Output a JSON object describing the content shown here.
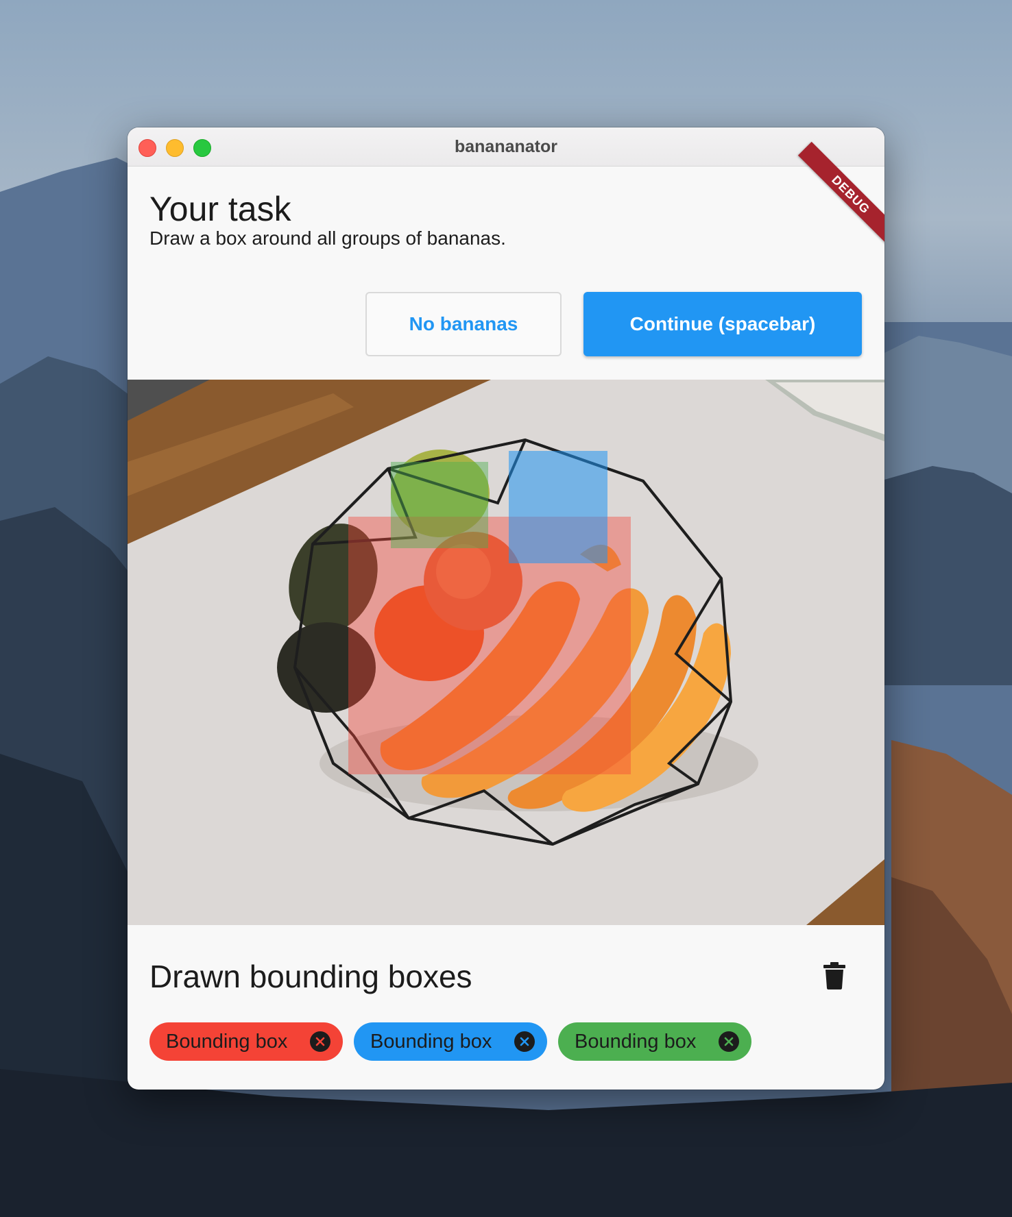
{
  "window": {
    "title": "banananator",
    "debug_banner": "DEBUG"
  },
  "task": {
    "heading": "Your task",
    "instruction": "Draw a box around all groups of bananas."
  },
  "actions": {
    "no_bananas_label": "No bananas",
    "continue_label": "Continue (spacebar)"
  },
  "colors": {
    "primary": "#2196f3",
    "chip_red": "#f44336",
    "chip_blue": "#2196f3",
    "chip_green": "#4caf50"
  },
  "boxes_section": {
    "heading": "Drawn bounding boxes",
    "clear_icon": "trash-icon",
    "chips": [
      {
        "label": "Bounding box",
        "color": "red"
      },
      {
        "label": "Bounding box",
        "color": "blue"
      },
      {
        "label": "Bounding box",
        "color": "green"
      }
    ]
  }
}
